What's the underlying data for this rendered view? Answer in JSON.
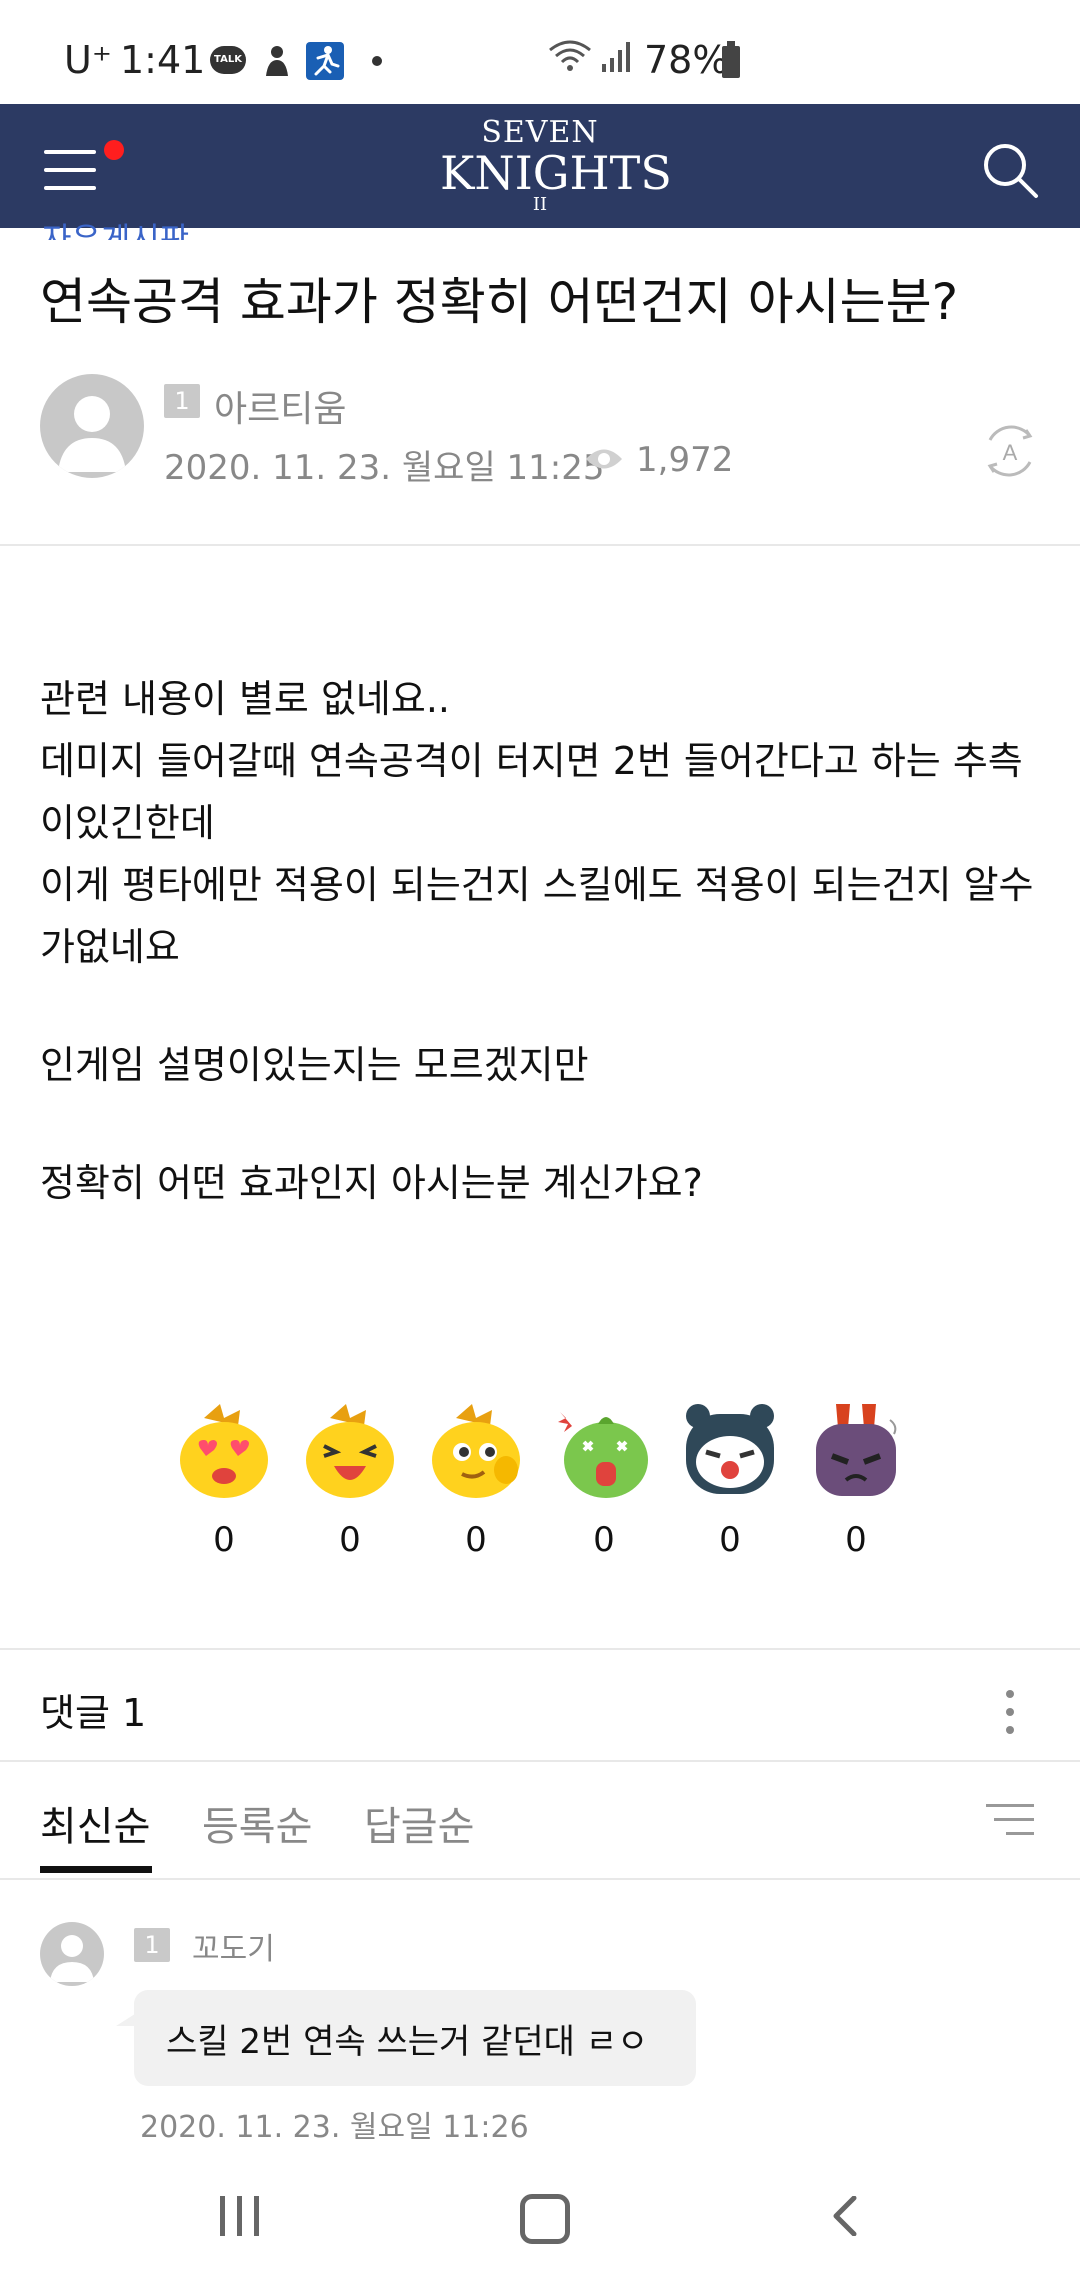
{
  "status_bar": {
    "carrier": "U⁺",
    "time": "1:41",
    "notif_icons": [
      "talk-icon",
      "person-icon",
      "running-icon",
      "more-dot-icon"
    ],
    "talk_label": "TALK",
    "battery": "78%"
  },
  "header": {
    "logo_line1": "SEVEN",
    "logo_line2": "KNIGHTS",
    "logo_line3": "II",
    "menu_has_notification": true,
    "colors": {
      "background": "#2c3a63",
      "notification_dot": "#ff1e1e"
    }
  },
  "post": {
    "board": "자유게시판",
    "title": "연속공격 효과가 정확히 어떤건지 아시는분?",
    "author_level": "1",
    "author": "아르티움",
    "date": "2020. 11. 23. 월요일 11:25",
    "views": "1,972",
    "body": [
      "관련 내용이 별로 없네요..",
      "데미지 들어갈때 연속공격이 터지면 2번 들어간다고 하는 추측이있긴한데",
      "이게 평타에만 적용이 되는건지 스킬에도 적용이 되는건지 알수가없네요",
      "",
      "인게임 설명이있는지는 모르겠지만",
      "",
      "정확히 어떤 효과인지 아시는분 계신가요?"
    ]
  },
  "reactions": [
    {
      "icon": "love-eyes-emoji-icon",
      "count": "0"
    },
    {
      "icon": "laughing-emoji-icon",
      "count": "0"
    },
    {
      "icon": "thinking-emoji-icon",
      "count": "0"
    },
    {
      "icon": "shocked-emoji-icon",
      "count": "0"
    },
    {
      "icon": "sad-emoji-icon",
      "count": "0"
    },
    {
      "icon": "angry-emoji-icon",
      "count": "0"
    }
  ],
  "comments_section": {
    "header": "댓글 1",
    "tabs": [
      "최신순",
      "등록순",
      "답글순"
    ],
    "active_tab": "최신순",
    "comments": [
      {
        "level": "1",
        "author": "꼬도기",
        "text": "스킬 2번 연속 쓰는거 같던대 ㄹㅇ",
        "date": "2020. 11. 23. 월요일 11:26"
      }
    ]
  },
  "nav_bar": {
    "buttons": [
      "recents-icon",
      "home-icon",
      "back-icon"
    ]
  }
}
